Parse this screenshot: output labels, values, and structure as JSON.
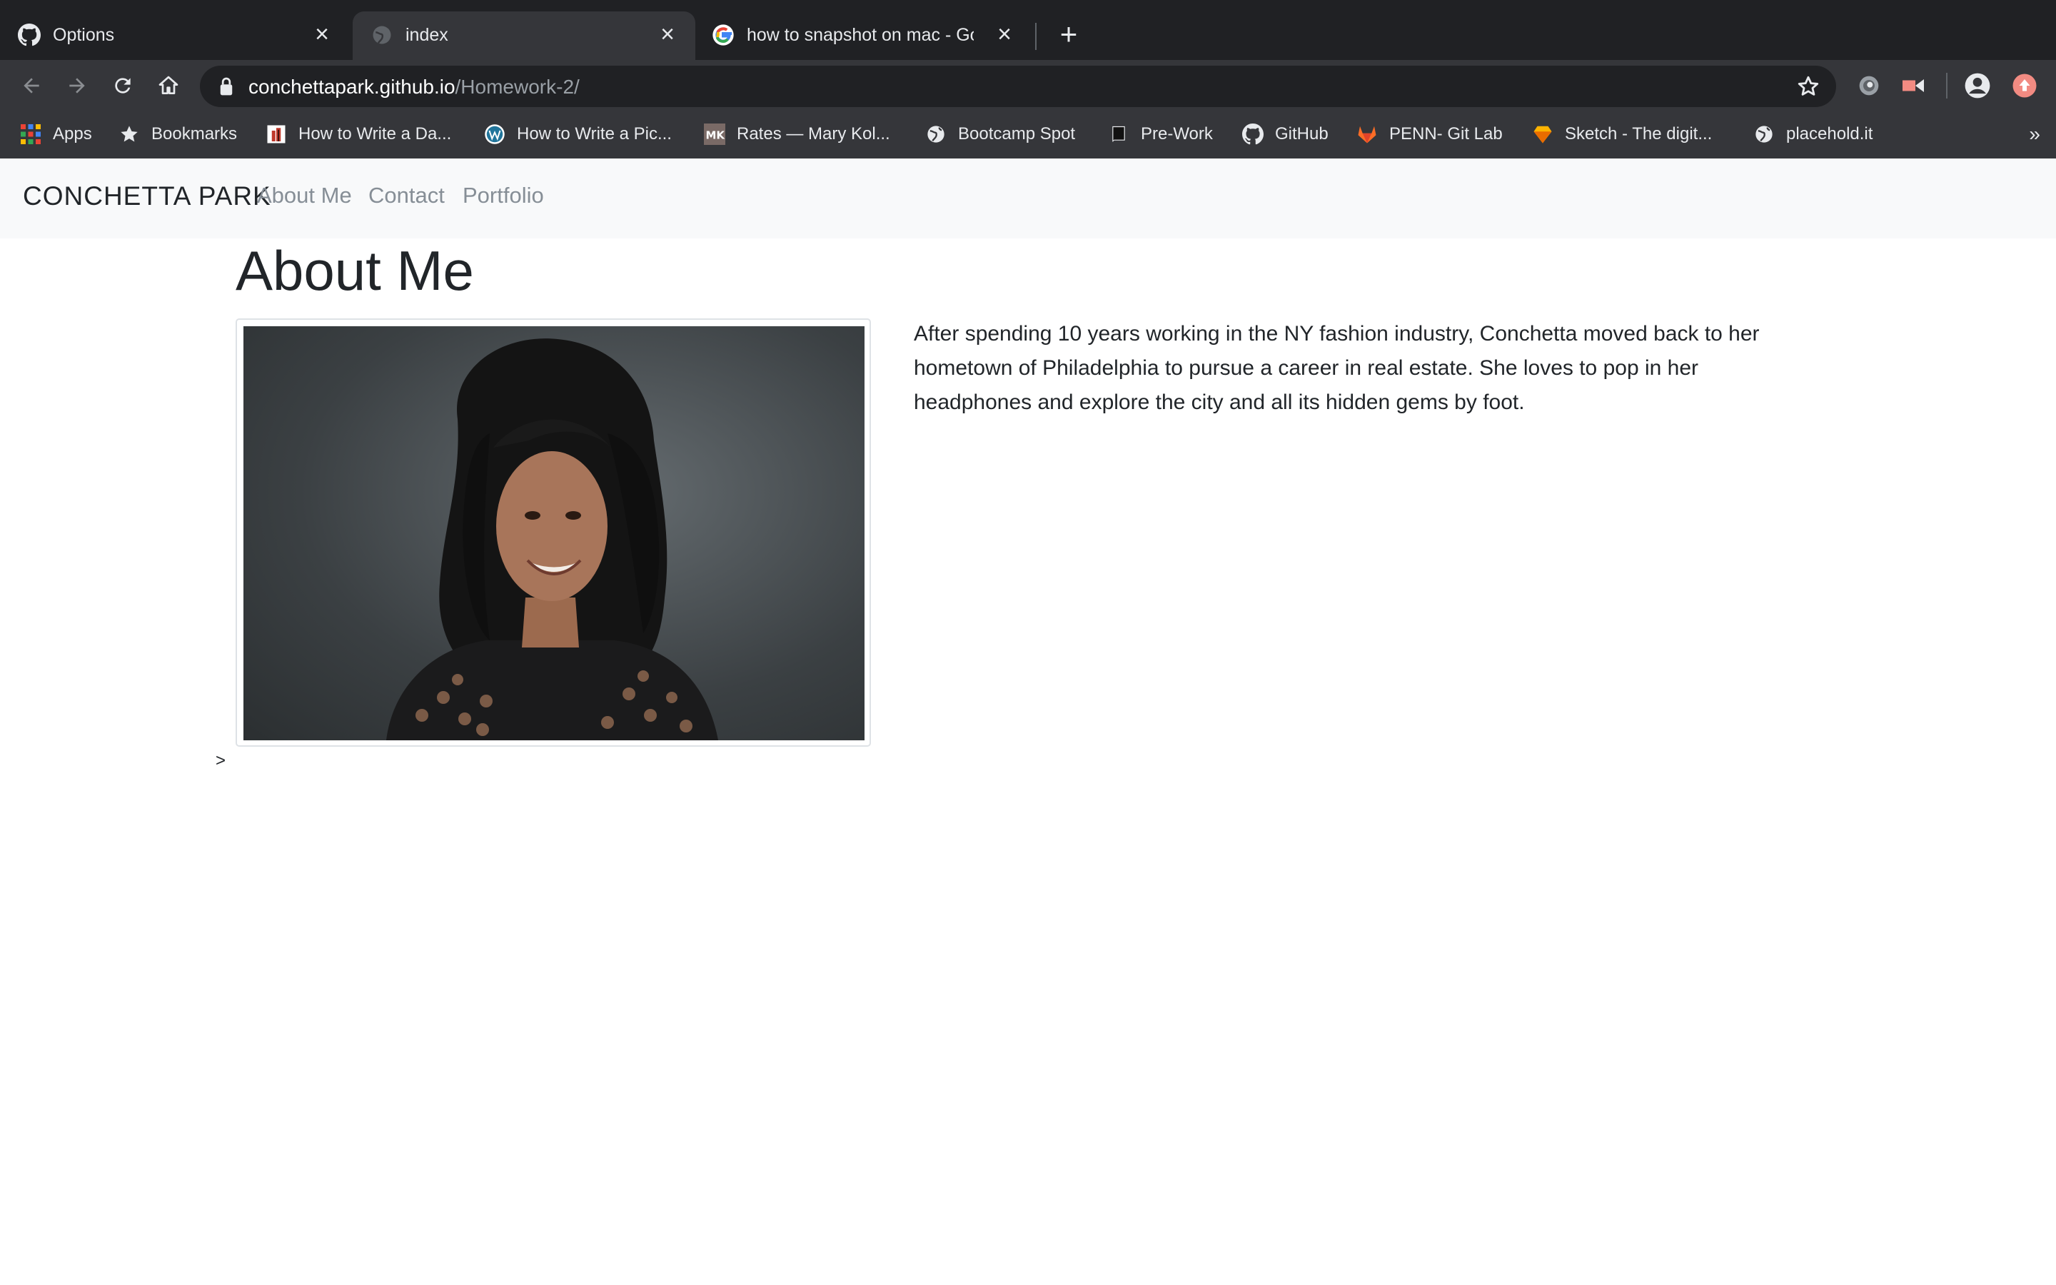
{
  "browser": {
    "tabs": [
      {
        "title": "Options",
        "icon": "github-icon"
      },
      {
        "title": "index",
        "icon": "globe-icon",
        "active": true
      },
      {
        "title": "how to snapshot on mac - Goo",
        "icon": "google-icon"
      }
    ],
    "url_host": "conchettapark.github.io",
    "url_path": "/Homework-2/",
    "bookmarks": [
      {
        "label": "Apps",
        "icon": "apps-grid-icon"
      },
      {
        "label": "Bookmarks",
        "icon": "star-icon"
      },
      {
        "label": "How to Write a Da...",
        "icon": "article-icon"
      },
      {
        "label": "How to Write a Pic...",
        "icon": "wordpress-icon"
      },
      {
        "label": "Rates — Mary Kol...",
        "icon": "mk-logo-icon"
      },
      {
        "label": "Bootcamp Spot",
        "icon": "globe-icon"
      },
      {
        "label": "Pre-Work",
        "icon": "book-icon"
      },
      {
        "label": "GitHub",
        "icon": "github-icon"
      },
      {
        "label": "PENN- Git Lab",
        "icon": "gitlab-icon"
      },
      {
        "label": "Sketch - The digit...",
        "icon": "sketch-icon"
      },
      {
        "label": "placehold.it",
        "icon": "globe-icon"
      }
    ],
    "more": "»"
  },
  "site": {
    "brand": "CONCHETTA PARK",
    "nav": [
      "About Me",
      "Contact",
      "Portfolio"
    ]
  },
  "main": {
    "title": "About Me",
    "photo_alt": "Portrait of Conchetta Park",
    "bio": "After spending 10 years working in the NY fashion industry, Conchetta moved back to her hometown of Philadelphia to pursue a career in real estate. She loves to pop in her headphones and explore the city and all its hidden gems by foot.",
    "stray_char": ">"
  }
}
